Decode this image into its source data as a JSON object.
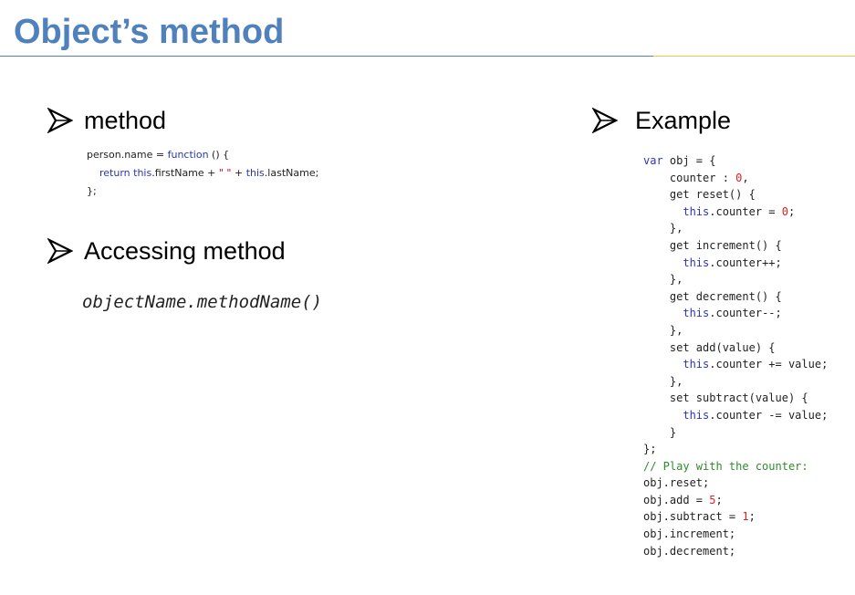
{
  "slide": {
    "title": "Object’s method",
    "colors": {
      "title": "#4f81bd",
      "rule_left": "#4f81bd",
      "rule_right": "#f2c14e",
      "keyword": "#2a35b8",
      "string": "#d0021b",
      "number": "#e0201e",
      "comment": "#2e8b2e"
    }
  },
  "bullets": {
    "icon": "arrow-bullet-icon",
    "method": "method",
    "accessing": "Accessing method",
    "example": "Example"
  },
  "method_code": {
    "line1": {
      "a": "person.name = ",
      "kw": "function",
      "b": " () {"
    },
    "line2": {
      "indent": "    ",
      "kw1": "return",
      "sp": " ",
      "kw2": "this",
      "a": ".firstName + ",
      "str": "\" \"",
      "b": " + ",
      "kw3": "this",
      "c": ".lastName;"
    },
    "line3": "};"
  },
  "access_code": "objectName.methodName()",
  "example_code": {
    "l1": {
      "kw": "var",
      "a": " obj = {"
    },
    "l2": {
      "a": "    counter : ",
      "num": "0",
      "b": ","
    },
    "l3": "    get reset() {",
    "l4": {
      "indent": "      ",
      "kw": "this",
      "a": ".counter = ",
      "num": "0",
      "b": ";"
    },
    "l5": "    },",
    "l6": "    get increment() {",
    "l7": {
      "indent": "      ",
      "kw": "this",
      "a": ".counter++;"
    },
    "l8": "    },",
    "l9": "    get decrement() {",
    "l10": {
      "indent": "      ",
      "kw": "this",
      "a": ".counter--;"
    },
    "l11": "    },",
    "l12": "    set add(value) {",
    "l13": {
      "indent": "      ",
      "kw": "this",
      "a": ".counter += value;"
    },
    "l14": "    },",
    "l15": "    set subtract(value) {",
    "l16": {
      "indent": "      ",
      "kw": "this",
      "a": ".counter -= value;"
    },
    "l17": "    }",
    "l18": "};",
    "l19": "// Play with the counter:",
    "l20": "obj.reset;",
    "l21": {
      "a": "obj.add = ",
      "num": "5",
      "b": ";"
    },
    "l22": {
      "a": "obj.subtract = ",
      "num": "1",
      "b": ";"
    },
    "l23": "obj.increment;",
    "l24": "obj.decrement;"
  }
}
